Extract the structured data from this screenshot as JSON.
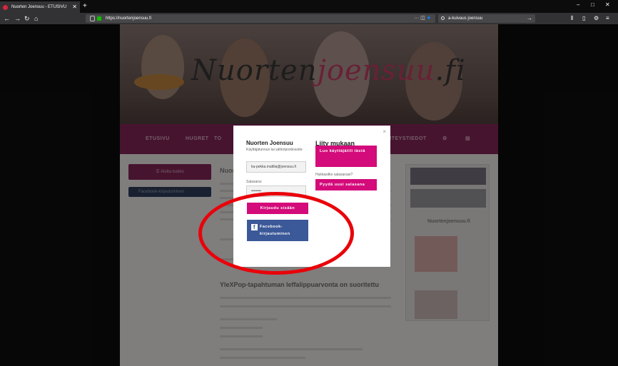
{
  "browser": {
    "tab_title": "Nuorten Joensuu - ETUSIVU",
    "url": "https://nuortenjoensuu.fi",
    "search_value": "a-kuivaus joensuu",
    "url_right_icons": "··· ",
    "window_controls": [
      "–",
      "□",
      "✕"
    ]
  },
  "site": {
    "logo_left": "Nuorten",
    "logo_pink": "joensuu",
    "logo_right": ".fi",
    "menu": [
      "ETUSIVU",
      "HUGRET",
      "TO",
      "YHTEYSTIEDOT",
      "⚙",
      "▤"
    ],
    "side_button_1": "☰  Aloita tuokio",
    "side_button_2": "Facebook-kirjautuminen",
    "ghost_title": "Nuor",
    "ghost_article_title": "YleXPop-tapahtuman leffalippuarvonta on suoritettu",
    "sidebar_title": "Nuortenjoensuu.fi"
  },
  "modal": {
    "close": "×",
    "left_title": "Nuorten Joensuu",
    "left_subtitle": "Käyttäjätunnus tai sähköpostiosoite:",
    "email_value": "ka-pekka.mattila@joensuu.fi",
    "password_label": "Salasana:",
    "password_value": "••••••••",
    "login_button": "Kirjaudu sisään",
    "facebook_button": "Facebook-kirjautuminen",
    "right_title": "Liity mukaan",
    "create_button": "Luo käyttäjätili tästä",
    "forgot_text": "Hukkasitko salasanasi?",
    "reset_button": "Pyydä uusi salasana"
  },
  "annotation": {
    "color": "#e8030a"
  }
}
